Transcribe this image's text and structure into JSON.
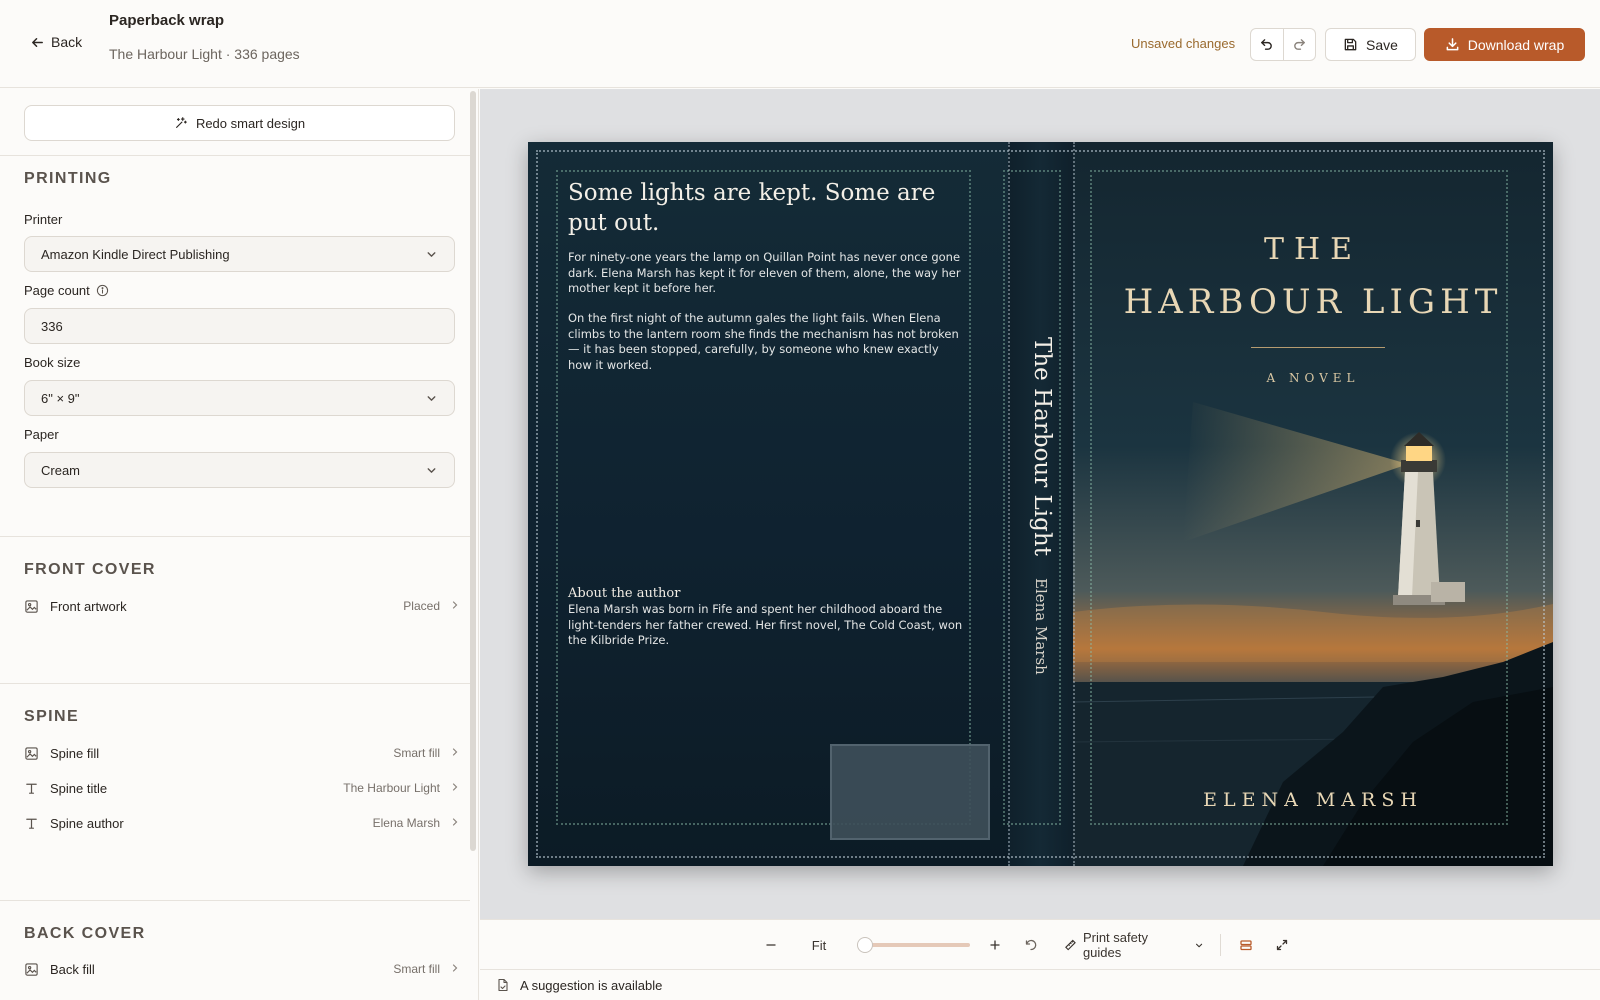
{
  "header": {
    "back_label": "Back",
    "title": "Paperback wrap",
    "subtitle": "The Harbour Light · 336 pages",
    "unsaved": "Unsaved changes",
    "save_label": "Save",
    "download_label": "Download wrap"
  },
  "sidebar": {
    "redo_label": "Redo smart design",
    "printing": {
      "title": "PRINTING",
      "printer_label": "Printer",
      "printer_value": "Amazon Kindle Direct Publishing",
      "page_count_label": "Page count",
      "page_count_value": "336",
      "book_size_label": "Book size",
      "book_size_value": "6\" × 9\"",
      "paper_label": "Paper",
      "paper_value": "Cream"
    },
    "front_cover": {
      "title": "FRONT COVER",
      "items": [
        {
          "label": "Front artwork",
          "value": "Placed"
        }
      ]
    },
    "spine": {
      "title": "SPINE",
      "items": [
        {
          "label": "Spine fill",
          "value": "Smart fill"
        },
        {
          "label": "Spine title",
          "value": "The Harbour Light"
        },
        {
          "label": "Spine author",
          "value": "Elena Marsh"
        }
      ]
    },
    "back_cover": {
      "title": "BACK COVER",
      "items": [
        {
          "label": "Back fill",
          "value": "Smart fill"
        }
      ]
    }
  },
  "cover": {
    "back": {
      "headline": "Some lights are kept. Some are put out.",
      "p1": "For ninety-one years the lamp on Quillan Point has never once gone dark. Elena Marsh has kept it for eleven of them, alone, the way her mother kept it before her.",
      "p2": "On the first night of the autumn gales the light fails. When Elena climbs to the lantern room she finds the mechanism has not broken — it has been stopped, carefully, by someone who knew exactly how it worked.",
      "about_title": "About the author",
      "about_text": "Elena Marsh was born in Fife and spent her childhood aboard the light-tenders her father crewed. Her first novel, The Cold Coast, won the Kilbride Prize."
    },
    "spine": {
      "title": "The Harbour Light",
      "author": "Elena Marsh"
    },
    "front": {
      "the": "THE",
      "title": "HARBOUR LIGHT",
      "tagline": "A NOVEL",
      "author": "ELENA MARSH"
    }
  },
  "toolbar": {
    "fit_label": "Fit",
    "zoom_percent": 0,
    "guides_label": "Print safety guides"
  },
  "status": {
    "suggestion": "A suggestion is available"
  },
  "colors": {
    "accent": "#b85a2a",
    "unsaved": "#9a6a2e",
    "cover_bg": "#10212c",
    "title_gold": "#e8d7b5"
  }
}
